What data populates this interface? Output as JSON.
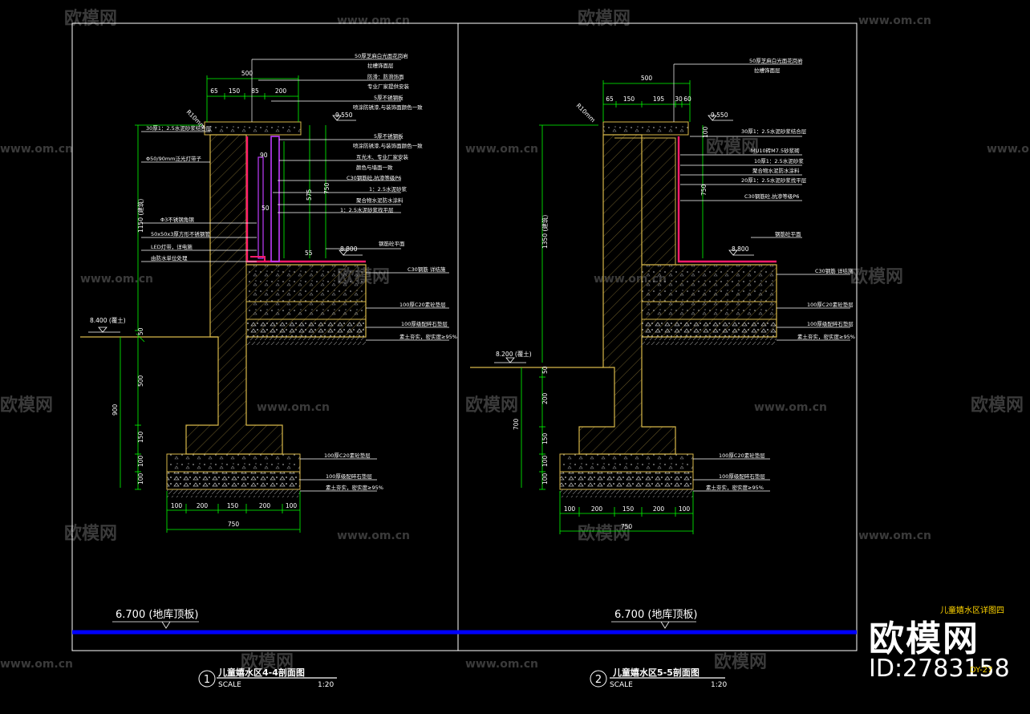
{
  "colors": {
    "background": "#000000",
    "frame": "#ffffff",
    "dims": "#00ff00",
    "structure": "#d8b84a",
    "labels": "#ffffff",
    "waterproof": "#ff1b6b",
    "blue_line": "#0000ff",
    "yellow": "#ffd500"
  },
  "watermarks": {
    "brand": "欧模网",
    "url": "www.om.cn"
  },
  "right_badge": {
    "brand": "欧模网",
    "id": "ID:2783158",
    "sheet_title": "儿童嬉水区详图四",
    "page_no": "DY-27"
  },
  "left": {
    "title": "儿童嬉水区4-4剖面图",
    "scale_label": "SCALE",
    "scale": "1:20",
    "num": "1",
    "floor_level": "6.700 (地库顶板)",
    "radius": "R10mm",
    "top_dims": [
      "65",
      "150",
      "85",
      "200"
    ],
    "top_total": "500",
    "notes": [
      "50厚芝麻白光面花岗岩",
      "拉槽饰面层",
      "防滑：防滑饰面",
      "专业厂家提供安装",
      "5厚不锈钢板",
      "喷涂防锈漆,与装饰面颜色一致",
      "5厚不锈钢板",
      "喷涂防锈漆,与装饰面颜色一致",
      "互光木、专业厂家安装",
      "颜色与墙面一致",
      "C30钢筋砼,抗渗等级P6",
      "1：2.5水泥砂浆",
      "聚合物水泥防水涂料",
      "1：2.5水泥砂浆找平层"
    ],
    "left_notes": [
      "30厚1：2.5水泥砂浆结合层",
      "Φ50/90mm泛光灯带子",
      "Φ3不锈钢角钢",
      "50x50x3厚方形不锈钢管",
      "LED灯带，详电施",
      "由防水单位处理"
    ],
    "levels": [
      "9.550",
      "8.800",
      "8.400 (覆土)"
    ],
    "right_layers": [
      "C30钢筋  详结施",
      "100厚C20素砼垫层",
      "100厚级配碎石垫层",
      "素土夯实，密实度≥95%"
    ],
    "foot_layers": [
      "100厚C20素砼垫层",
      "100厚级配碎石垫层",
      "素土夯实，密实度≥95%"
    ],
    "vdims": [
      "1150 (建筑)",
      "500",
      "150",
      "100",
      "100",
      "900",
      "50"
    ],
    "inner_dims": [
      "90",
      "30",
      "80",
      "50",
      "575",
      "750",
      "55",
      "30"
    ],
    "bottom_dims": [
      "100",
      "200",
      "150",
      "200",
      "100"
    ],
    "bottom_total": "750"
  },
  "right": {
    "title": "儿童嬉水区5-5剖面图",
    "scale_label": "SCALE",
    "scale": "1:20",
    "num": "2",
    "floor_level": "6.700 (地库顶板)",
    "radius": "R10mm",
    "top_dims": [
      "65",
      "150",
      "195",
      "30",
      "60"
    ],
    "top_total": "500",
    "notes": [
      "50厚芝麻白光面花岗岩",
      "拉槽饰面层",
      "30厚1：2.5水泥砂浆结合层",
      "MU10砖M7.5砂浆砌",
      "10厚1：2.5水泥砂浆",
      "聚合物水泥防水涂料",
      "20厚1：2.5水泥砂浆找平层",
      "C30钢筋砼,抗渗等级P6"
    ],
    "levels": [
      "9.550",
      "8.800",
      "8.200 (覆土)"
    ],
    "right_layers": [
      "C30钢筋  详结施",
      "100厚C20素砼垫层",
      "100厚级配碎石垫层",
      "素土夯实，密实度≥95%"
    ],
    "foot_layers": [
      "100厚C20素砼垫层",
      "100厚级配碎石垫层",
      "素土夯实，密实度≥95%"
    ],
    "side_note": "钢筋砼平面",
    "vdims": [
      "1350 (建筑)",
      "50",
      "200",
      "700",
      "150",
      "100",
      "100"
    ],
    "inner_dims": [
      "100",
      "20",
      "750"
    ],
    "bottom_dims": [
      "100",
      "200",
      "150",
      "200",
      "100"
    ],
    "bottom_total": "750"
  }
}
